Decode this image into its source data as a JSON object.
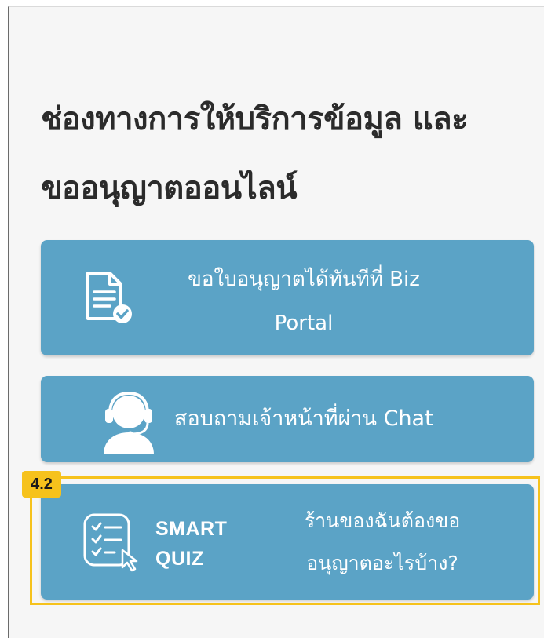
{
  "section": {
    "title_line1": "ช่องทางการให้บริการข้อมูล และ",
    "title_line2": "ขออนุญาตออนไลน์"
  },
  "cards": {
    "biz_portal": {
      "label": "ขอใบอนุญาตได้ทันทีที่ Biz Portal",
      "icon": "document-check-icon"
    },
    "chat": {
      "label": "สอบถามเจ้าหน้าที่ผ่าน Chat",
      "icon": "headset-agent-icon"
    },
    "smart_quiz": {
      "brand_line1": "SMART",
      "brand_line2": "QUIZ",
      "label": "ร้านของฉันต้องขออนุญาตอะไรบ้าง?",
      "icon": "checklist-cursor-icon"
    }
  },
  "annotation": {
    "badge": "4.2"
  },
  "colors": {
    "card_bg": "#5ba3c6",
    "highlight": "#f6c21c",
    "heading_text": "#2b2b2b",
    "panel_bg": "#f6f6f6"
  }
}
